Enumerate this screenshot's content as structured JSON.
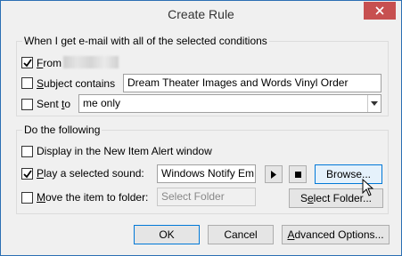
{
  "window": {
    "title": "Create Rule"
  },
  "conditions": {
    "heading": "When I get e-mail with all of the selected conditions",
    "from_label_u": "F",
    "from_label_rest": "rom",
    "subject_label_u": "S",
    "subject_label_rest": "ubject contains",
    "subject_value": "Dream Theater Images and Words Vinyl Order",
    "sent_label_pre": "Sent ",
    "sent_label_u": "t",
    "sent_label_rest": "o",
    "sent_value": "me only"
  },
  "actions": {
    "heading": "Do the following",
    "alert_label": "Display in the New Item Alert window",
    "sound_label_u": "P",
    "sound_label_rest": "lay a selected sound:",
    "sound_value": "Windows Notify Em",
    "browse_label": "Browse...",
    "move_label_u": "M",
    "move_label_rest": "ove the item to folder:",
    "folder_placeholder": "Select Folder",
    "select_folder_label_pre": "S",
    "select_folder_label_u": "e",
    "select_folder_label_rest": "lect Folder..."
  },
  "footer": {
    "ok_label": "OK",
    "cancel_label": "Cancel",
    "advanced_label_pre": "",
    "advanced_label_u": "A",
    "advanced_label_rest": "dvanced Options..."
  },
  "state": {
    "from_checked": true,
    "subject_checked": false,
    "sent_checked": false,
    "alert_checked": false,
    "sound_checked": true,
    "move_checked": false
  },
  "colors": {
    "accent": "#0078d7",
    "close_button": "#c75050",
    "window_border": "#2b6fb3"
  },
  "icons": [
    "close-icon",
    "checkmark-icon",
    "dropdown-arrow-icon",
    "play-icon",
    "stop-icon",
    "mouse-cursor-icon"
  ]
}
